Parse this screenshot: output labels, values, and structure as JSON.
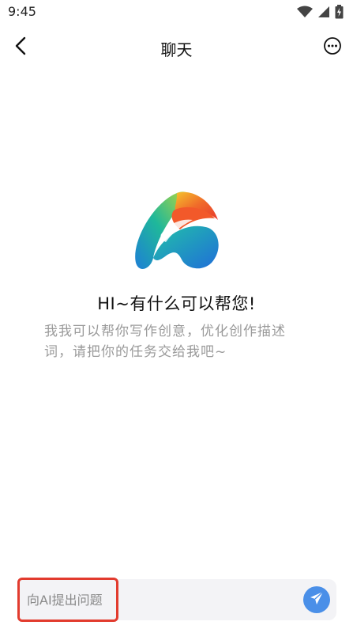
{
  "status_bar": {
    "time": "9:45",
    "icons": [
      "wifi-icon",
      "signal-icon",
      "battery-charging-icon"
    ]
  },
  "header": {
    "title": "聊天",
    "back_icon": "chevron-left-icon",
    "more_icon": "more-circle-icon"
  },
  "welcome": {
    "greeting": "HI~有什么可以帮您!",
    "intro": "我我可以帮你写作创意，优化创作描述词，请把你的任务交给我吧~"
  },
  "input": {
    "value": "",
    "placeholder": "向AI提出问题",
    "send_icon": "paper-plane-icon"
  },
  "colors": {
    "accent": "#4a8fe8",
    "highlight_border": "#e23b2e",
    "intro_text": "#9a9a9a"
  }
}
